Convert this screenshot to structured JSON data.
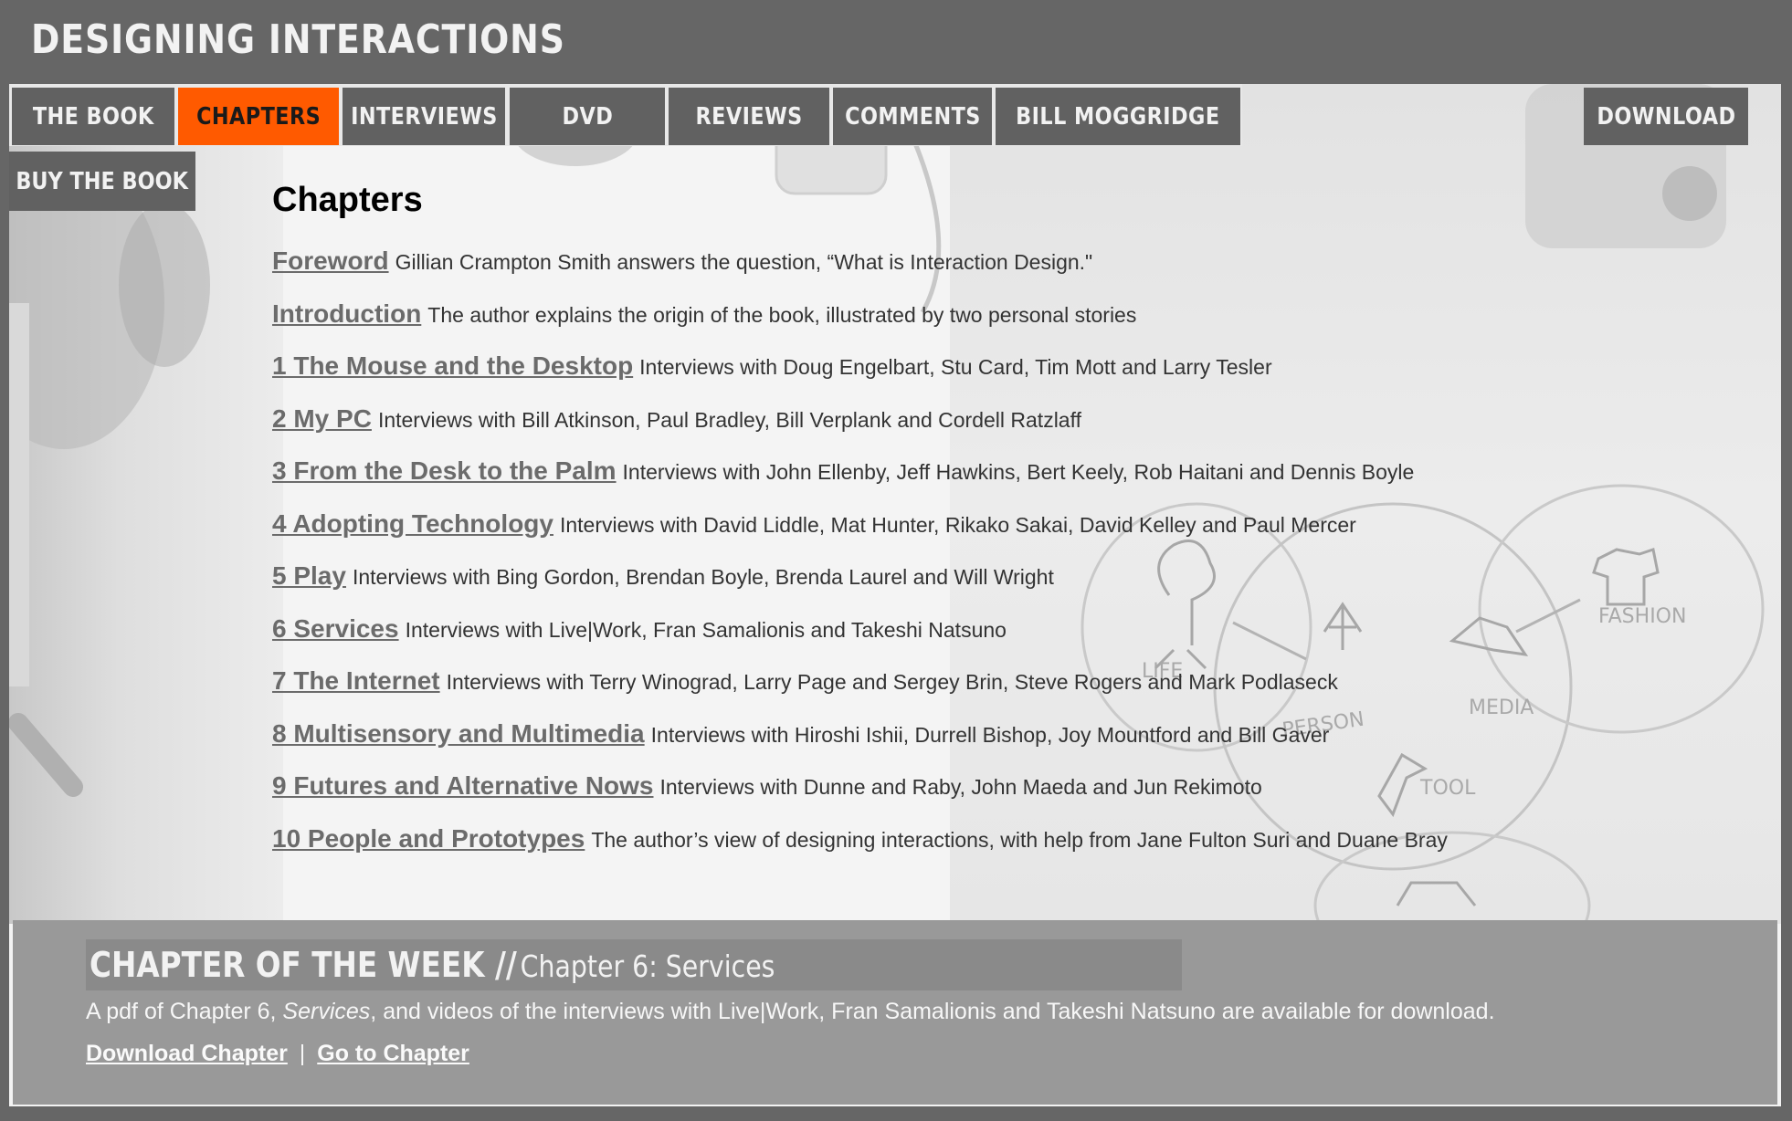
{
  "site": {
    "title": "DESIGNING INTERACTIONS"
  },
  "nav": {
    "items": [
      {
        "label": "THE BOOK",
        "active": false
      },
      {
        "label": "CHAPTERS",
        "active": true
      },
      {
        "label": "INTERVIEWS",
        "active": false
      },
      {
        "label": "DVD",
        "active": false
      },
      {
        "label": "REVIEWS",
        "active": false
      },
      {
        "label": "COMMENTS",
        "active": false
      },
      {
        "label": "BILL MOGGRIDGE",
        "active": false
      }
    ],
    "download": "DOWNLOAD",
    "buy": "BUY THE BOOK",
    "active_color": "#ff5a00"
  },
  "main": {
    "heading": "Chapters",
    "chapters": [
      {
        "title": "Foreword",
        "desc": "Gillian Crampton Smith answers the question, “What is Interaction Design.\""
      },
      {
        "title": "Introduction",
        "desc": "The author explains the origin of the book, illustrated by two personal stories"
      },
      {
        "title": "1 The Mouse and the Desktop",
        "desc": "Interviews with Doug Engelbart, Stu Card, Tim Mott and Larry Tesler"
      },
      {
        "title": "2 My PC",
        "desc": "Interviews with Bill Atkinson, Paul Bradley, Bill Verplank and Cordell Ratzlaff"
      },
      {
        "title": "3 From the Desk to the Palm",
        "desc": "Interviews with John Ellenby, Jeff Hawkins, Bert Keely, Rob Haitani and Dennis Boyle"
      },
      {
        "title": "4 Adopting Technology",
        "desc": "Interviews with David Liddle, Mat Hunter, Rikako Sakai, David Kelley and Paul Mercer"
      },
      {
        "title": "5 Play",
        "desc": "Interviews with Bing Gordon, Brendan Boyle, Brenda Laurel and Will Wright"
      },
      {
        "title": "6 Services",
        "desc": "Interviews with Live|Work, Fran Samalionis and Takeshi Natsuno"
      },
      {
        "title": "7 The Internet",
        "desc": "Interviews with Terry Winograd, Larry Page and Sergey Brin, Steve Rogers and Mark Podlaseck"
      },
      {
        "title": "8 Multisensory and Multimedia",
        "desc": "Interviews with Hiroshi Ishii, Durrell Bishop, Joy Mountford and Bill Gaver"
      },
      {
        "title": "9 Futures and Alternative Nows",
        "desc": "Interviews with Dunne and Raby, John Maeda and Jun Rekimoto"
      },
      {
        "title": "10 People and Prototypes",
        "desc": "The author’s view of designing interactions, with help from Jane Fulton Suri and Duane Bray"
      }
    ]
  },
  "sketch": {
    "labels": [
      "LIFE",
      "PERSON",
      "MEDIA",
      "TOOL",
      "FASHION"
    ]
  },
  "cotw": {
    "label": "CHAPTER OF THE WEEK //",
    "title": "Chapter 6: Services",
    "desc_before": "A pdf of Chapter 6, ",
    "desc_italic": "Services",
    "desc_after": ", and videos of the interviews with Live|Work, Fran Samalionis and Takeshi Natsuno are available for download.",
    "download_link": "Download Chapter",
    "separator": "|",
    "goto_link": "Go to Chapter"
  }
}
